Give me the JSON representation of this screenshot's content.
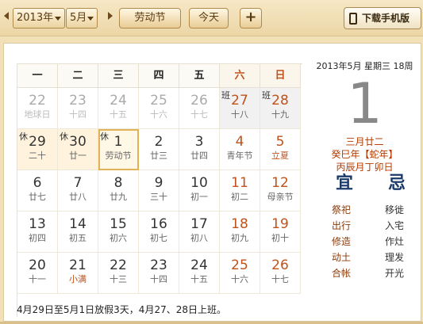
{
  "toolbar": {
    "year": "2013年",
    "month": "5月",
    "holiday": "劳动节",
    "today": "今天",
    "add": "+",
    "download": "下载手机版"
  },
  "weekdays": [
    "一",
    "二",
    "三",
    "四",
    "五",
    "六",
    "日"
  ],
  "weeks": [
    [
      {
        "n": "22",
        "l": "地球日"
      },
      {
        "n": "23",
        "l": "十四"
      },
      {
        "n": "24",
        "l": "十五"
      },
      {
        "n": "25",
        "l": "十六"
      },
      {
        "n": "26",
        "l": "十七"
      },
      {
        "n": "27",
        "l": "十八",
        "tag": "班"
      },
      {
        "n": "28",
        "l": "十九",
        "tag": "班"
      }
    ],
    [
      {
        "n": "29",
        "l": "二十",
        "tag": "休"
      },
      {
        "n": "30",
        "l": "廿一",
        "tag": "休"
      },
      {
        "n": "1",
        "l": "劳动节",
        "tag": "休"
      },
      {
        "n": "2",
        "l": "廿三"
      },
      {
        "n": "3",
        "l": "廿四"
      },
      {
        "n": "4",
        "l": "青年节"
      },
      {
        "n": "5",
        "l": "立夏"
      }
    ],
    [
      {
        "n": "6",
        "l": "廿七"
      },
      {
        "n": "7",
        "l": "廿八"
      },
      {
        "n": "8",
        "l": "廿九"
      },
      {
        "n": "9",
        "l": "三十"
      },
      {
        "n": "10",
        "l": "初一"
      },
      {
        "n": "11",
        "l": "初二"
      },
      {
        "n": "12",
        "l": "母亲节"
      }
    ],
    [
      {
        "n": "13",
        "l": "初四"
      },
      {
        "n": "14",
        "l": "初五"
      },
      {
        "n": "15",
        "l": "初六"
      },
      {
        "n": "16",
        "l": "初七"
      },
      {
        "n": "17",
        "l": "初八"
      },
      {
        "n": "18",
        "l": "初九"
      },
      {
        "n": "19",
        "l": "初十"
      }
    ],
    [
      {
        "n": "20",
        "l": "十一"
      },
      {
        "n": "21",
        "l": "小满"
      },
      {
        "n": "22",
        "l": "十三"
      },
      {
        "n": "23",
        "l": "十四"
      },
      {
        "n": "24",
        "l": "十五"
      },
      {
        "n": "25",
        "l": "十六"
      },
      {
        "n": "26",
        "l": "十七"
      }
    ]
  ],
  "note": "4月29日至5月1日放假3天，4月27、28日上班。",
  "side": {
    "date_line": "2013年5月 星期三 18周",
    "big_day": "1",
    "lunar": "三月廿二",
    "ganzhi_year": "癸巳年【蛇年】",
    "ganzhi_month_day": "丙辰月丁卯日",
    "yi": "宜",
    "ji": "忌",
    "yi_items": [
      "祭祀",
      "出行",
      "修造",
      "动土",
      "合帐"
    ],
    "ji_items": [
      "移徙",
      "入宅",
      "作灶",
      "理发",
      "开光"
    ]
  },
  "colors": {
    "accent": "#c0521b",
    "bar": "#ecd6a6"
  }
}
